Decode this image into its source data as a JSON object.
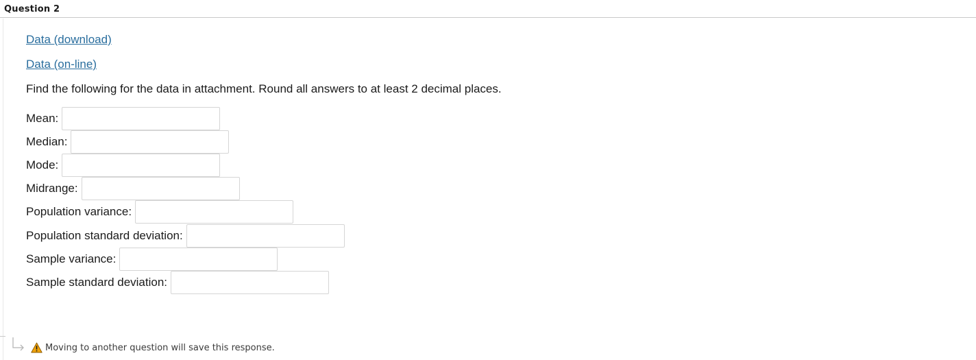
{
  "question": {
    "title": "Question 2"
  },
  "links": {
    "download": "Data (download)",
    "online": "Data (on-line)"
  },
  "instruction": "Find the following for the data in attachment. Round all answers to at least 2 decimal places.",
  "fields": [
    {
      "label": "Mean:",
      "value": ""
    },
    {
      "label": "Median:",
      "value": ""
    },
    {
      "label": "Mode:",
      "value": ""
    },
    {
      "label": "Midrange:",
      "value": ""
    },
    {
      "label": "Population variance:",
      "value": ""
    },
    {
      "label": "Population standard deviation:",
      "value": ""
    },
    {
      "label": "Sample variance:",
      "value": ""
    },
    {
      "label": "Sample standard deviation:",
      "value": ""
    }
  ],
  "footer": {
    "message": "Moving to another question will save this response.",
    "icons": [
      "return-arrow-icon",
      "warning-icon"
    ],
    "warning_color": "#f0a30a"
  },
  "colors": {
    "link": "#2a6e9e",
    "text": "#1b1b1b",
    "input_border": "#d5d5d5"
  }
}
